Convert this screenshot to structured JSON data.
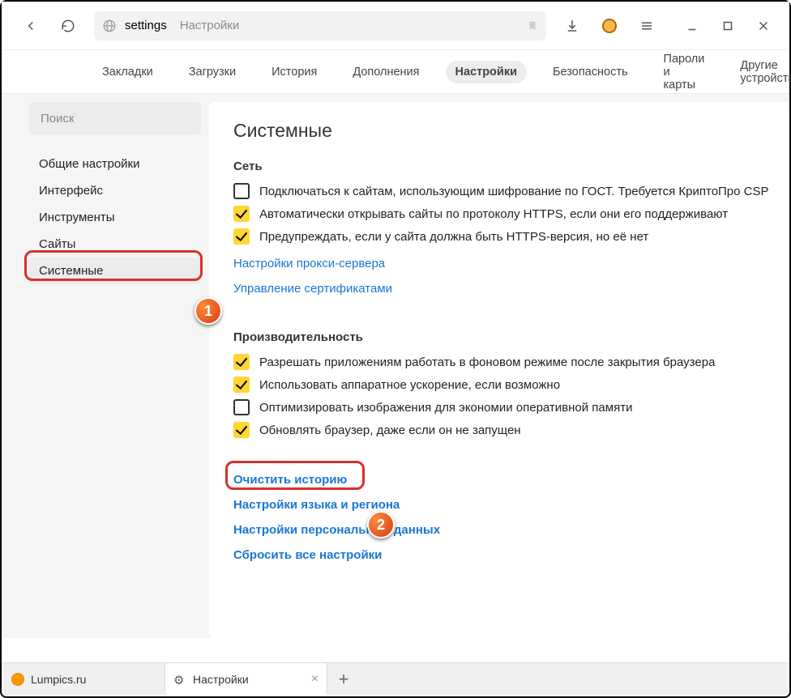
{
  "addressbar": {
    "host": "settings",
    "path": "Настройки"
  },
  "nav": {
    "items": [
      {
        "label": "Закладки"
      },
      {
        "label": "Загрузки"
      },
      {
        "label": "История"
      },
      {
        "label": "Дополнения"
      },
      {
        "label": "Настройки"
      },
      {
        "label": "Безопасность"
      },
      {
        "label": "Пароли и карты"
      },
      {
        "label": "Другие устройства"
      }
    ],
    "active_index": 4
  },
  "sidebar": {
    "search_placeholder": "Поиск",
    "items": [
      {
        "label": "Общие настройки"
      },
      {
        "label": "Интерфейс"
      },
      {
        "label": "Инструменты"
      },
      {
        "label": "Сайты"
      },
      {
        "label": "Системные"
      }
    ],
    "active_index": 4
  },
  "page": {
    "title": "Системные",
    "network": {
      "title": "Сеть",
      "checkboxes": [
        {
          "checked": false,
          "label": "Подключаться к сайтам, использующим шифрование по ГОСТ. Требуется КриптоПро CSP"
        },
        {
          "checked": true,
          "label": "Автоматически открывать сайты по протоколу HTTPS, если они его поддерживают"
        },
        {
          "checked": true,
          "label": "Предупреждать, если у сайта должна быть HTTPS-версия, но её нет"
        }
      ],
      "links": [
        "Настройки прокси-сервера",
        "Управление сертификатами"
      ]
    },
    "performance": {
      "title": "Производительность",
      "checkboxes": [
        {
          "checked": true,
          "label": "Разрешать приложениям работать в фоновом режиме после закрытия браузера"
        },
        {
          "checked": true,
          "label": "Использовать аппаратное ускорение, если возможно"
        },
        {
          "checked": false,
          "label": "Оптимизировать изображения для экономии оперативной памяти"
        },
        {
          "checked": true,
          "label": "Обновлять браузер, даже если он не запущен"
        }
      ]
    },
    "bottom_links": [
      "Очистить историю",
      "Настройки языка и региона",
      "Настройки персональных данных",
      "Сбросить все настройки"
    ]
  },
  "markers": {
    "m1": "1",
    "m2": "2"
  },
  "tabs": {
    "items": [
      {
        "title": "Lumpics.ru"
      },
      {
        "title": "Настройки"
      }
    ],
    "active_index": 1
  }
}
